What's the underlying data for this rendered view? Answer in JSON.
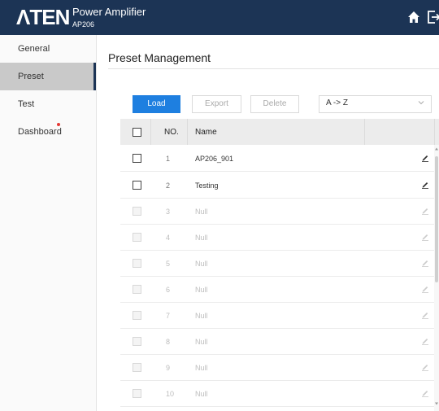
{
  "header": {
    "logo": "ΛTEN",
    "app_title": "Power Amplifier",
    "model": "AP206",
    "icons": [
      "home-icon",
      "logout-icon"
    ]
  },
  "sidebar": {
    "items": [
      {
        "label": "General",
        "active": false
      },
      {
        "label": "Preset",
        "active": true
      },
      {
        "label": "Test",
        "active": false
      },
      {
        "label": "Dashboard",
        "active": false,
        "notification": true
      }
    ]
  },
  "main": {
    "title": "Preset Management",
    "toolbar": {
      "load": "Load",
      "export": "Export",
      "delete": "Delete",
      "sort_value": "A -> Z"
    },
    "table": {
      "columns": [
        "NO.",
        "Name"
      ],
      "rows": [
        {
          "no": "1",
          "name": "AP206_901",
          "enabled": true
        },
        {
          "no": "2",
          "name": "Testing",
          "enabled": true
        },
        {
          "no": "3",
          "name": "Null",
          "enabled": false
        },
        {
          "no": "4",
          "name": "Null",
          "enabled": false
        },
        {
          "no": "5",
          "name": "Null",
          "enabled": false
        },
        {
          "no": "6",
          "name": "Null",
          "enabled": false
        },
        {
          "no": "7",
          "name": "Null",
          "enabled": false
        },
        {
          "no": "8",
          "name": "Null",
          "enabled": false
        },
        {
          "no": "9",
          "name": "Null",
          "enabled": false
        },
        {
          "no": "10",
          "name": "Null",
          "enabled": false
        }
      ]
    }
  },
  "colors": {
    "header_bg": "#1c3455",
    "primary_button": "#1e7fe0",
    "notification_dot": "#e53935",
    "active_sidebar": "#c9c9c9"
  }
}
